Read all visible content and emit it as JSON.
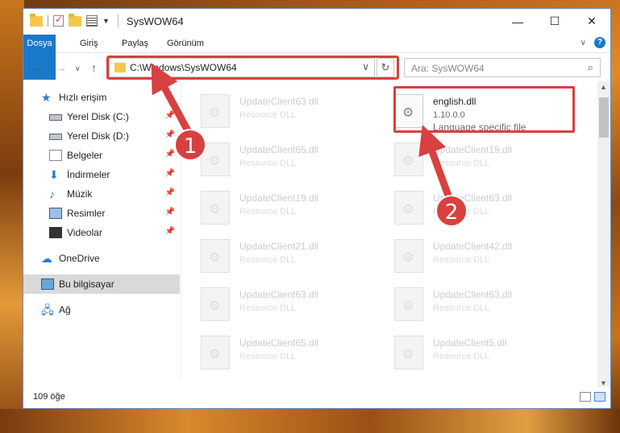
{
  "window": {
    "title": "SysWOW64"
  },
  "ribbon": {
    "tabs": [
      {
        "label": "Dosya"
      },
      {
        "label": "Giriş"
      },
      {
        "label": "Paylaş"
      },
      {
        "label": "Görünüm"
      }
    ]
  },
  "nav": {
    "address": "C:\\Windows\\SysWOW64",
    "search_placeholder": "Ara: SysWOW64"
  },
  "sidebar": {
    "items": [
      {
        "label": "Hızlı erişim",
        "icon": "star-icon"
      },
      {
        "label": "Yerel Disk (C:)",
        "icon": "drive-icon",
        "pinned": true
      },
      {
        "label": "Yerel Disk (D:)",
        "icon": "drive-icon",
        "pinned": true
      },
      {
        "label": "Belgeler",
        "icon": "documents-icon",
        "pinned": true
      },
      {
        "label": "İndirmeler",
        "icon": "download-icon",
        "pinned": true
      },
      {
        "label": "Müzik",
        "icon": "music-icon",
        "pinned": true
      },
      {
        "label": "Resimler",
        "icon": "pictures-icon",
        "pinned": true
      },
      {
        "label": "Videolar",
        "icon": "videos-icon",
        "pinned": true
      },
      {
        "label": "OneDrive",
        "icon": "onedrive-icon"
      },
      {
        "label": "Bu bilgisayar",
        "icon": "this-pc-icon",
        "selected": true
      },
      {
        "label": "Ağ",
        "icon": "network-icon"
      }
    ]
  },
  "files": [
    {
      "name": "UpdateClient63.dll",
      "desc": "Resource DLL"
    },
    {
      "name": "english.dll",
      "version": "1.10.0.0",
      "desc": "Language specific file",
      "highlighted": true
    },
    {
      "name": "UpdateClient65.dll",
      "desc": "Resource DLL"
    },
    {
      "name": "UpdateClient19.dll",
      "desc": "Resource DLL"
    },
    {
      "name": "UpdateClient19.dll",
      "desc": "Resource DLL"
    },
    {
      "name": "UpdateClient63.dll",
      "desc": "Resource DLL"
    },
    {
      "name": "UpdateClient21.dll",
      "desc": "Resource DLL"
    },
    {
      "name": "UpdateClient42.dll",
      "desc": "Resource DLL"
    },
    {
      "name": "UpdateClient63.dll",
      "desc": "Resource DLL"
    },
    {
      "name": "UpdateClient63.dll",
      "desc": "Resource DLL"
    },
    {
      "name": "UpdateClient65.dll",
      "desc": "Resource DLL"
    },
    {
      "name": "UpdateClient5.dll",
      "desc": "Resource DLL"
    }
  ],
  "status": {
    "count": "109 öğe"
  },
  "annotations": {
    "step1": "1",
    "step2": "2",
    "color": "#d94040"
  }
}
